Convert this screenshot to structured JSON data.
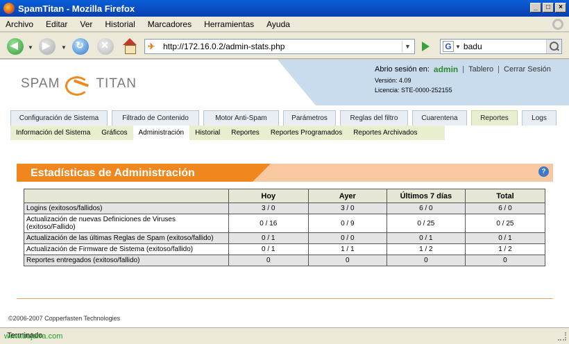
{
  "window": {
    "title": "SpamTitan - Mozilla Firefox"
  },
  "menu": [
    "Archivo",
    "Editar",
    "Ver",
    "Historial",
    "Marcadores",
    "Herramientas",
    "Ayuda"
  ],
  "navigation": {
    "url": "http://172.16.0.2/admin-stats.php",
    "search_value": "badu"
  },
  "header": {
    "logo_left": "SPAM",
    "logo_right": "TITAN",
    "session_label": "Abrio sesión en:",
    "username": "admin",
    "dashboard_link": "Tablero",
    "logout_link": "Cerrar Sesión",
    "version": "Versión: 4.09",
    "license": "Licencia: STE-0000-252155"
  },
  "tabs": [
    {
      "label": "Configuración de Sistema",
      "active": false
    },
    {
      "label": "Filtrado de Contenido",
      "active": false
    },
    {
      "label": "Motor Anti-Spam",
      "active": false
    },
    {
      "label": "Parámetros",
      "active": false
    },
    {
      "label": "Reglas del filtro",
      "active": false
    },
    {
      "label": "Cuarentena",
      "active": false
    },
    {
      "label": "Reportes",
      "active": true
    },
    {
      "label": "Logs",
      "active": false
    }
  ],
  "subtabs": [
    {
      "label": "Información del Sistema",
      "active": false
    },
    {
      "label": "Gráficos",
      "active": false
    },
    {
      "label": "Administración",
      "active": true
    },
    {
      "label": "Historial",
      "active": false
    },
    {
      "label": "Reportes",
      "active": false
    },
    {
      "label": "Reportes Programados",
      "active": false
    },
    {
      "label": "Reportes Archivados",
      "active": false
    }
  ],
  "panel": {
    "title": "Estadísticas de Administración",
    "help": "?",
    "columns": [
      "",
      "Hoy",
      "Ayer",
      "Últimos 7 días",
      "Total"
    ],
    "rows": [
      {
        "label": "Logins (exitosos/fallidos)",
        "values": [
          "3 / 0",
          "3 / 0",
          "6 / 0",
          "6 / 0"
        ]
      },
      {
        "label": "Actualización de nuevas Definiciones de Viruses (exitoso/Fallido)",
        "values": [
          "0 / 16",
          "0 / 9",
          "0 / 25",
          "0 / 25"
        ]
      },
      {
        "label": "Actualización de las últimas Reglas de Spam (exitoso/fallido)",
        "values": [
          "0 / 1",
          "0 / 0",
          "0 / 1",
          "0 / 1"
        ]
      },
      {
        "label": "Actualización de Firmware de Sistema (exitoso/fallido)",
        "values": [
          "0 / 1",
          "1 / 1",
          "1 / 2",
          "1 / 2"
        ]
      },
      {
        "label": "Reportes entregados (exitoso/fallido)",
        "values": [
          "0",
          "0",
          "0",
          "0"
        ]
      }
    ]
  },
  "footer": {
    "copyright": "©2006-2007 Copperfasten Technologies"
  },
  "statusbar": {
    "text": "Terminado",
    "watermark": "www.bujarra.com"
  },
  "colors": {
    "accent_orange": "#f0861e",
    "header_blue": "#c9dcee",
    "active_tab": "#e7efd0",
    "username_green": "#2e8b2e"
  }
}
